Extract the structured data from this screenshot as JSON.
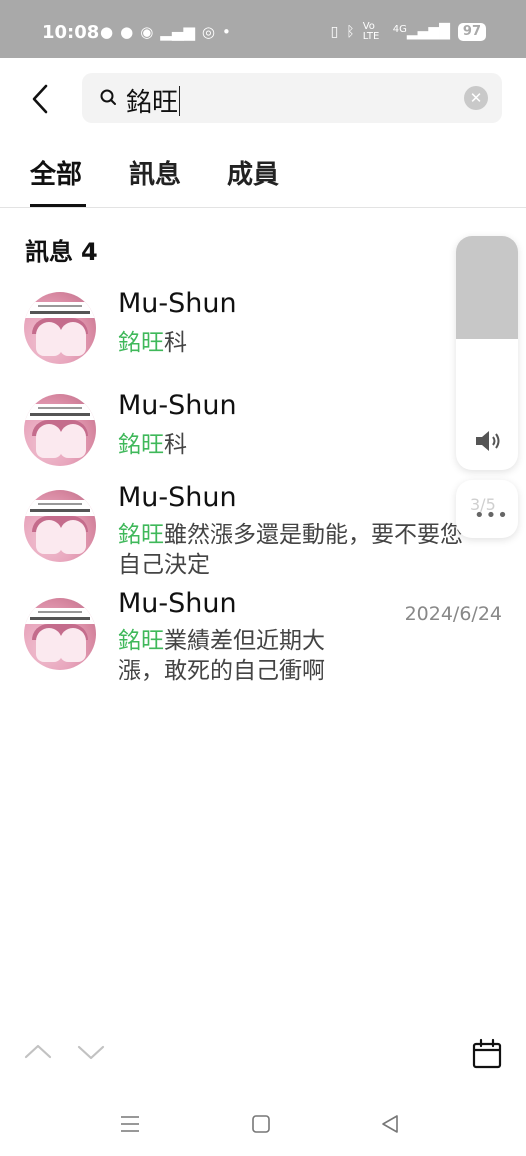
{
  "status_bar": {
    "time": "10:08",
    "left_icons": [
      "chat-bubble-icon",
      "chat-bubble-icon",
      "line-icon",
      "signal-bars-icon",
      "chrome-icon",
      "dot-icon"
    ],
    "network": "Vo LTE",
    "signal": "4G",
    "battery": "97"
  },
  "search": {
    "query": "銘旺"
  },
  "tabs": [
    {
      "label": "全部",
      "active": true
    },
    {
      "label": "訊息",
      "active": false
    },
    {
      "label": "成員",
      "active": false
    }
  ],
  "section": {
    "title": "訊息",
    "count": "4"
  },
  "results": [
    {
      "name": "Mu-Shun",
      "highlight": "銘旺",
      "rest": "科",
      "date": ""
    },
    {
      "name": "Mu-Shun",
      "highlight": "銘旺",
      "rest": "科",
      "date": ""
    },
    {
      "name": "Mu-Shun",
      "highlight": "銘旺",
      "rest": "雖然漲多還是動能，要不要您自己決定",
      "date": ""
    },
    {
      "name": "Mu-Shun",
      "highlight": "銘旺",
      "rest": "業績差但近期大漲，敢死的自己衝啊",
      "date": "2024/6/24"
    }
  ],
  "overlay": {
    "volume_level": 0.44,
    "counter": "3/5"
  }
}
